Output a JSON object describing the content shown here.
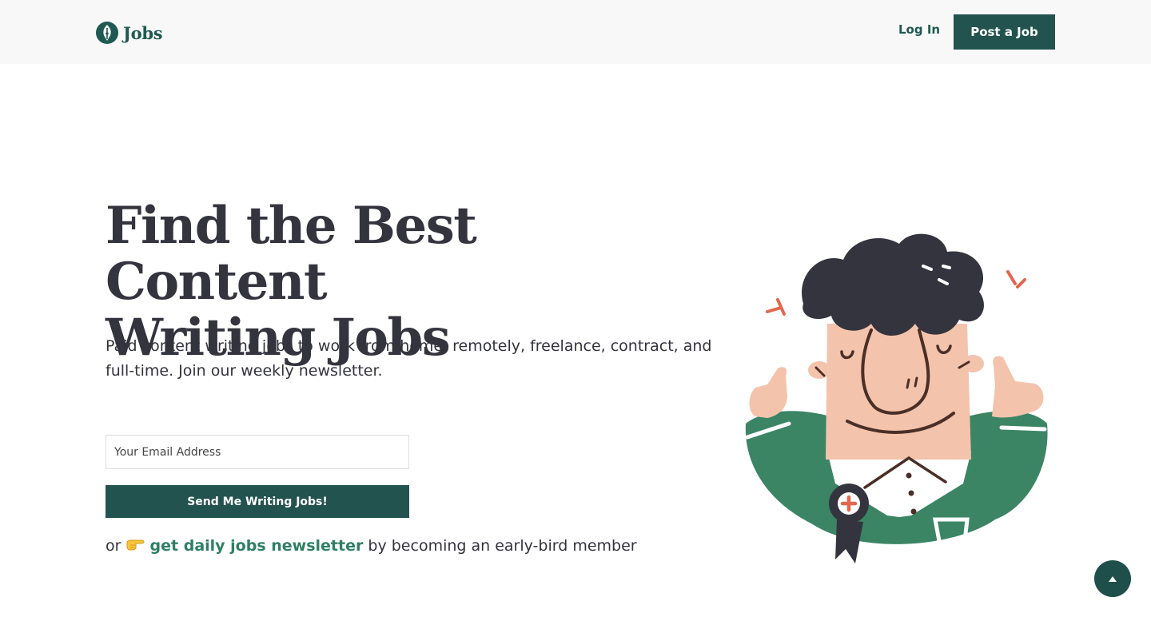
{
  "header": {
    "logo_text": "Jobs",
    "login_label": "Log In",
    "post_job_label": "Post a Job"
  },
  "hero": {
    "title_line1": "Find the Best Content",
    "title_line2": "Writing Jobs",
    "subtitle": "Paid content writing jobs to work from home, remotely, freelance, contract, and full-time. Join our weekly newsletter."
  },
  "signup": {
    "email_placeholder": "Your Email Address",
    "submit_label": "Send Me Writing Jobs!"
  },
  "cta": {
    "prefix": "or",
    "pointer_icon": "backhand-index-pointing-right",
    "link_text": "get daily jobs newsletter",
    "suffix": "by becoming an early-bird member"
  },
  "colors": {
    "brand": "#22534f",
    "link": "#2e8064",
    "shirt": "#3b8565",
    "skin": "#f4c3ac",
    "hair": "#34343f",
    "accent": "#e2674f"
  },
  "icons": {
    "logo": "pen-nib-icon",
    "scroll_top": "arrow-up-icon"
  }
}
